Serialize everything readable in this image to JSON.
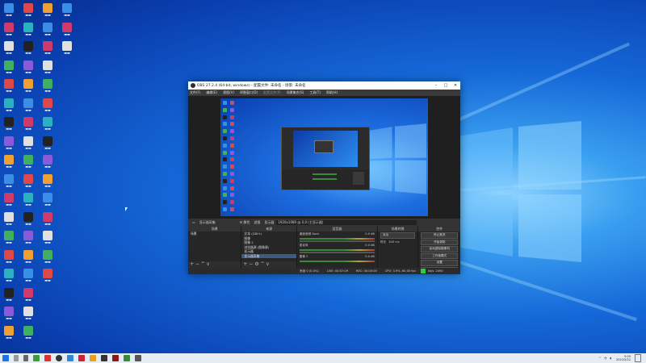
{
  "obs": {
    "title": "OBS 27.2.4 (64-bit, windows) - 配置文件: 未命名 - 场景: 未命名",
    "menu": [
      "文件(F)",
      "编辑(E)",
      "视图(V)",
      "停靠窗口(D)",
      "配置文件(P)",
      "场景集合(S)",
      "工具(T)",
      "帮助(H)"
    ],
    "source_bar": {
      "monitor_label": "显示器采集",
      "properties": "属性",
      "filter": "滤镜",
      "display_label": "显示器",
      "display_value": "1920x1080 @ 0,0 (主显示器)"
    },
    "docks": {
      "scenes": {
        "header": "场景",
        "items": [
          "场景"
        ]
      },
      "sources": {
        "header": "来源",
        "items": [
          "文本 (GDI+)",
          "图像",
          "图像 2",
          "浏览器源 (图像源)",
          "显示器",
          "显示器采集"
        ]
      },
      "mixer": {
        "header": "混音器",
        "channels": [
          {
            "name": "桌面音频 Dock",
            "db": "0.0 dB"
          },
          {
            "name": "麦克风",
            "db": "0.0 dB"
          },
          {
            "name": "图像 2",
            "db": "0.0 dB"
          }
        ]
      },
      "transitions": {
        "header": "场景转换",
        "type": "淡出",
        "duration_label": "时长",
        "duration": "300 ms"
      },
      "controls": {
        "header": "控件",
        "buttons": [
          "停止推流",
          "开始录制",
          "启动虚拟摄像机",
          "工作室模式",
          "设置",
          "退出"
        ]
      }
    },
    "status": {
      "dropped": "丢帧 0 (0.0%)",
      "live": "LIVE: 00:07:09",
      "rec": "REC: 00:00:00",
      "cpu": "CPU: 3.9%, 60.00 fps",
      "kbps": "kb/s: 2490"
    }
  },
  "taskbar": {
    "time": "9:29",
    "date": "2022/5/22"
  },
  "colors": {
    "accent": "#0a3fb0",
    "live_square": "#2ecc40"
  }
}
